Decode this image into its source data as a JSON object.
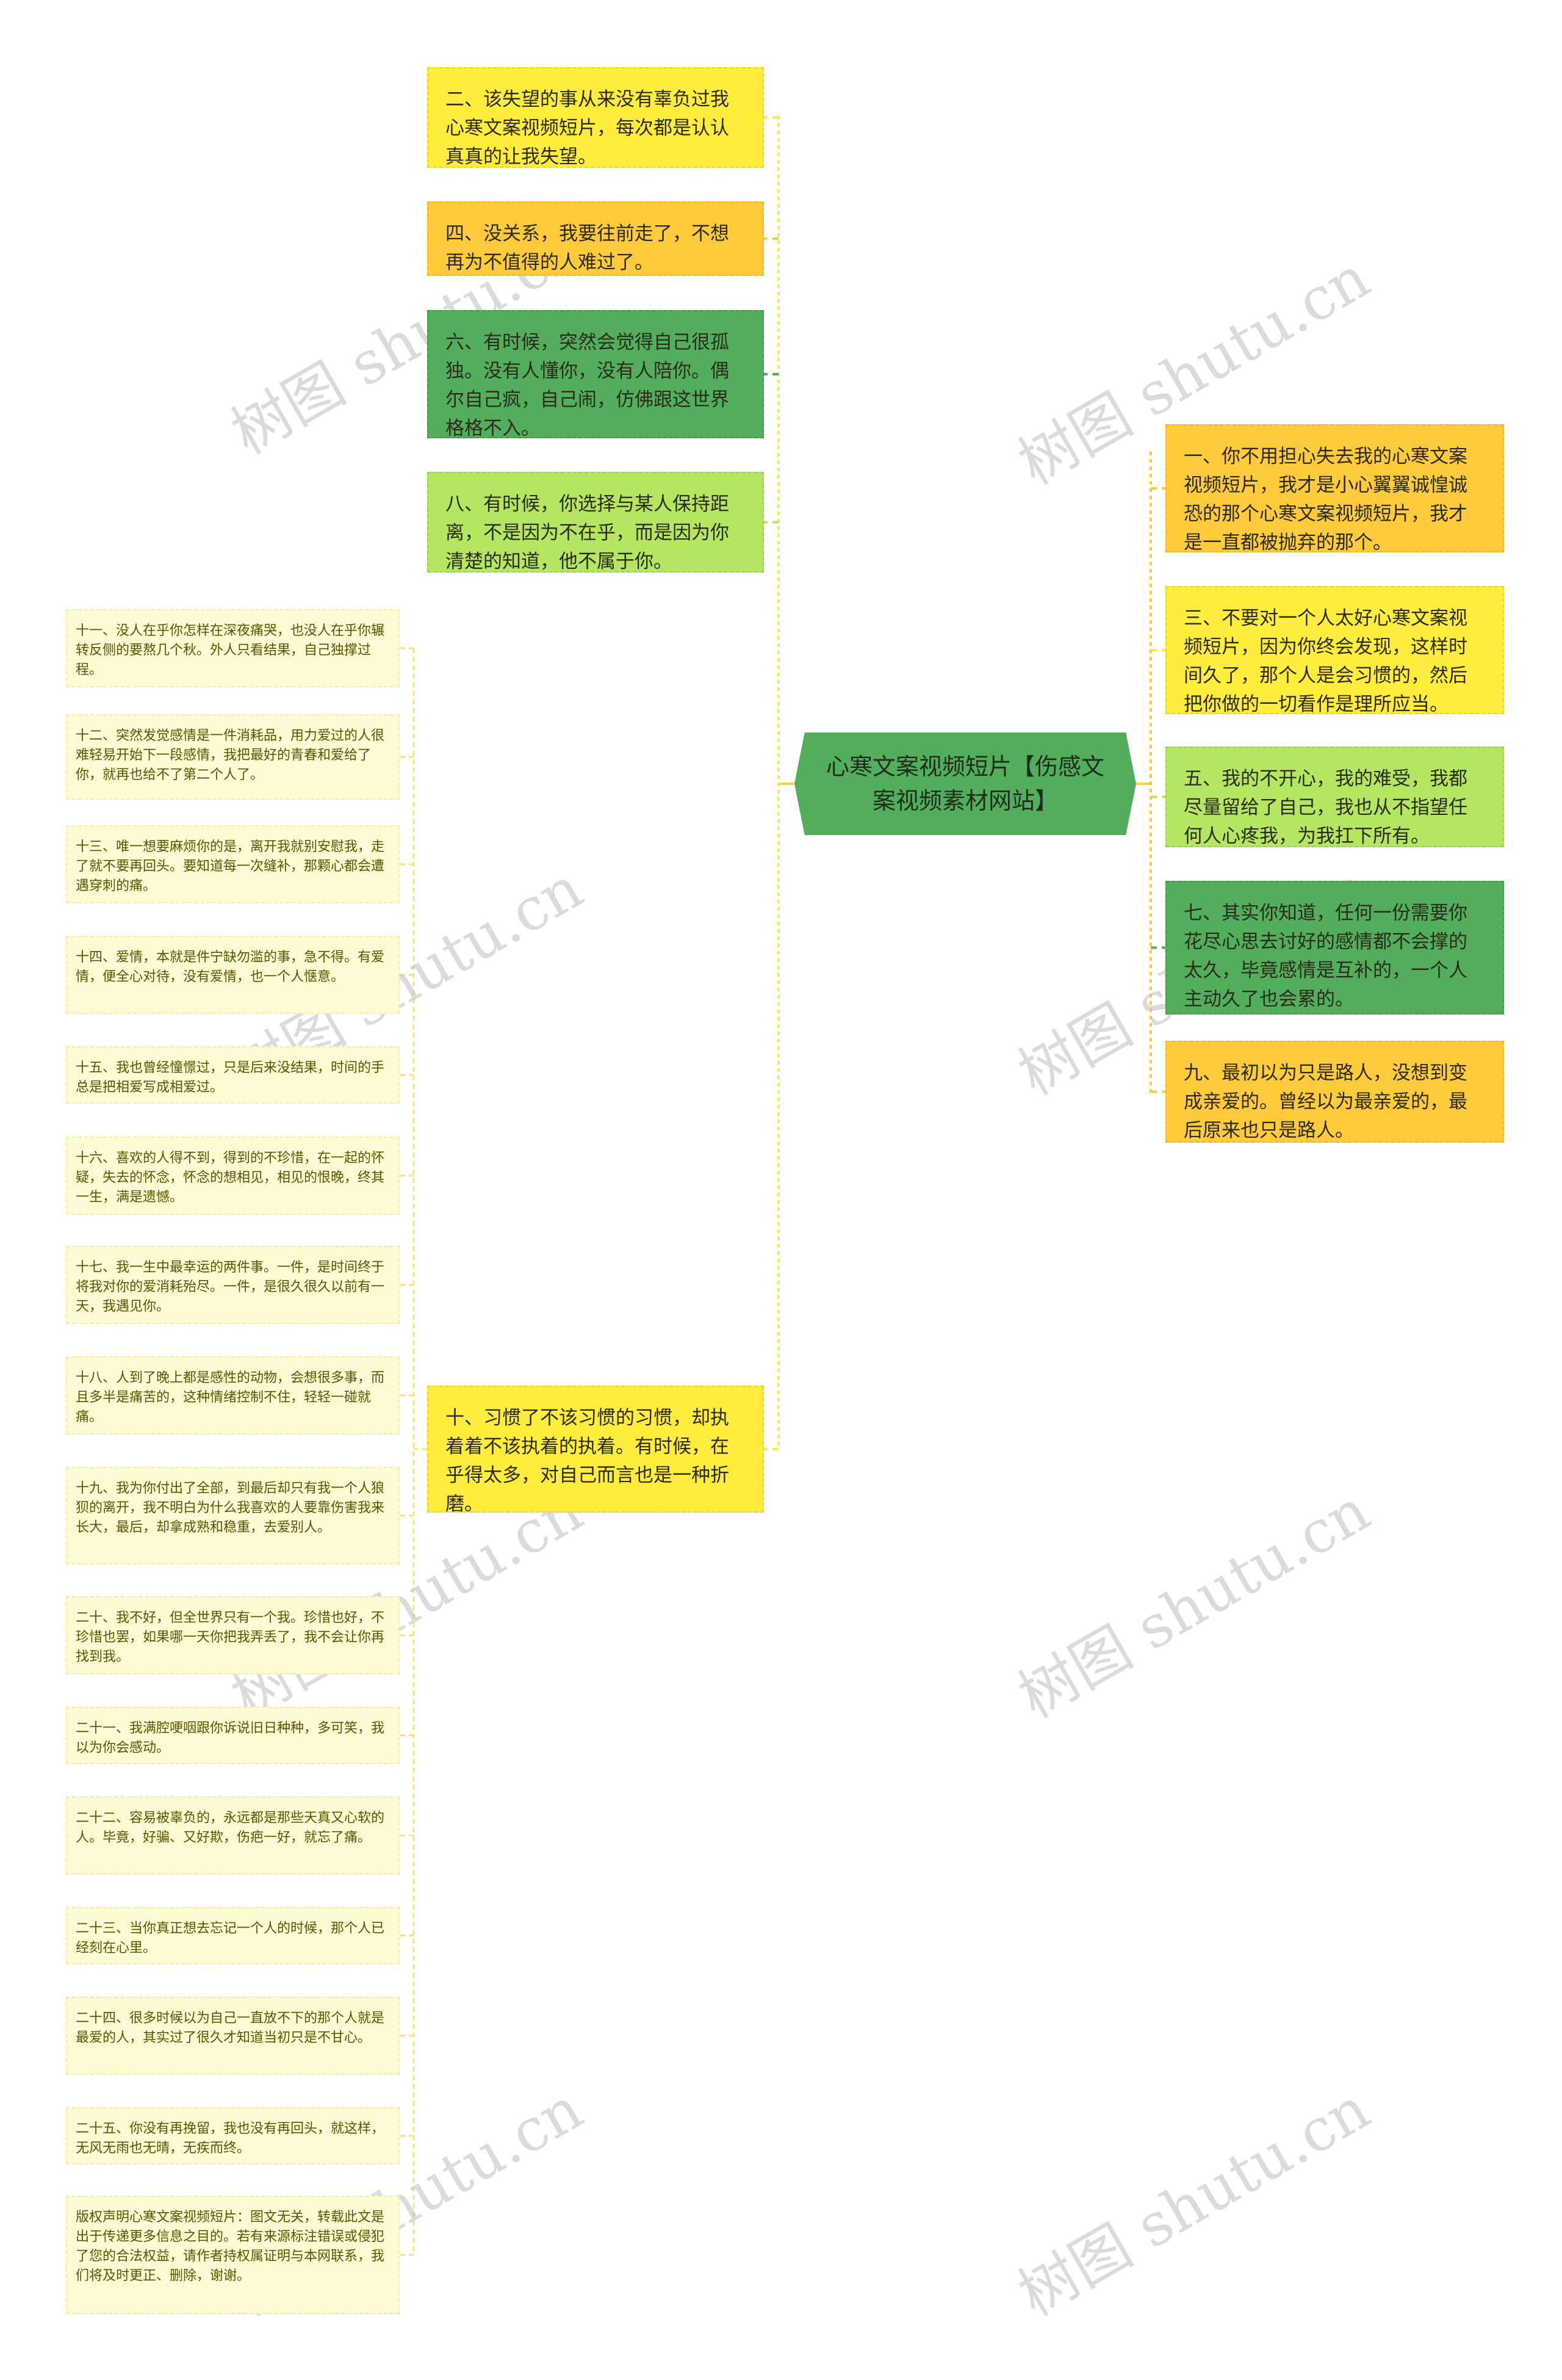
{
  "center": {
    "title": "心寒文案视频短片【伤感文案视频素材网站】"
  },
  "left_top_nodes": [
    {
      "text": "二、该失望的事从来没有辜负过我心寒文案视频短片，每次都是认认真真的让我失望。",
      "color": "#ffec3d"
    },
    {
      "text": "四、没关系，我要往前走了，不想再为不值得的人难过了。",
      "color": "#ffca3c"
    },
    {
      "text": "六、有时候，突然会觉得自己很孤独。没有人懂你，没有人陪你。偶尔自己疯，自己闹，仿佛跟这世界格格不入。",
      "color": "#52ae5c"
    },
    {
      "text": "八、有时候，你选择与某人保持距离，不是因为不在乎，而是因为你清楚的知道，他不属于你。",
      "color": "#b5e661"
    },
    {
      "text": "十、习惯了不该习惯的习惯，却执着着不该执着的执着。有时候，在乎得太多，对自己而言也是一种折磨。",
      "color": "#ffec3d"
    }
  ],
  "right_nodes": [
    {
      "text": "一、你不用担心失去我的心寒文案视频短片，我才是小心翼翼诚惶诚恐的那个心寒文案视频短片，我才是一直都被抛弃的那个。",
      "color": "#ffca3c"
    },
    {
      "text": "三、不要对一个人太好心寒文案视频短片，因为你终会发现，这样时间久了，那个人是会习惯的，然后把你做的一切看作是理所应当。",
      "color": "#ffec3d"
    },
    {
      "text": "五、我的不开心，我的难受，我都尽量留给了自己，我也从不指望任何人心疼我，为我扛下所有。",
      "color": "#b5e661"
    },
    {
      "text": "七、其实你知道，任何一份需要你花尽心思去讨好的感情都不会撑的太久，毕竟感情是互补的，一个人主动久了也会累的。",
      "color": "#52ae5c"
    },
    {
      "text": "九、最初以为只是路人，没想到变成亲爱的。曾经以为最亲爱的，最后原来也只是路人。",
      "color": "#ffca3c"
    }
  ],
  "left_sub_nodes": [
    {
      "text": "十一、没人在乎你怎样在深夜痛哭，也没人在乎你辗转反侧的要熬几个秋。外人只看结果，自己独撑过程。"
    },
    {
      "text": "十二、突然发觉感情是一件消耗品，用力爱过的人很难轻易开始下一段感情，我把最好的青春和爱给了你，就再也给不了第二个人了。"
    },
    {
      "text": "十三、唯一想要麻烦你的是，离开我就别安慰我，走了就不要再回头。要知道每一次缝补，那颗心都会遭遇穿刺的痛。"
    },
    {
      "text": "十四、爱情，本就是件宁缺勿滥的事，急不得。有爱情，便全心对待，没有爱情，也一个人惬意。"
    },
    {
      "text": "十五、我也曾经憧憬过，只是后来没结果，时间的手总是把相爱写成相爱过。"
    },
    {
      "text": "十六、喜欢的人得不到，得到的不珍惜，在一起的怀疑，失去的怀念，怀念的想相见，相见的恨晚，终其一生，满是遗憾。"
    },
    {
      "text": "十七、我一生中最幸运的两件事。一件，是时间终于将我对你的爱消耗殆尽。一件，是很久很久以前有一天，我遇见你。"
    },
    {
      "text": "十八、人到了晚上都是感性的动物，会想很多事，而且多半是痛苦的，这种情绪控制不住，轻轻一碰就痛。"
    },
    {
      "text": "十九、我为你付出了全部，到最后却只有我一个人狼狈的离开，我不明白为什么我喜欢的人要靠伤害我来长大，最后，却拿成熟和稳重，去爱别人。"
    },
    {
      "text": "二十、我不好，但全世界只有一个我。珍惜也好，不珍惜也罢，如果哪一天你把我弄丢了，我不会让你再找到我。"
    },
    {
      "text": "二十一、我满腔哽咽跟你诉说旧日种种，多可笑，我以为你会感动。"
    },
    {
      "text": "二十二、容易被辜负的，永远都是那些天真又心软的人。毕竟，好骗、又好欺，伤疤一好，就忘了痛。"
    },
    {
      "text": "二十三、当你真正想去忘记一个人的时候，那个人已经刻在心里。"
    },
    {
      "text": "二十四、很多时候以为自己一直放不下的那个人就是最爱的人，其实过了很久才知道当初只是不甘心。"
    },
    {
      "text": "二十五、你没有再挽留，我也没有再回头，就这样，无风无雨也无晴，无疾而终。"
    },
    {
      "text": "版权声明心寒文案视频短片：图文无关，转载此文是出于传递更多信息之目的。若有来源标注错误或侵犯了您的合法权益，请作者持权属证明与本网联系，我们将及时更正、删除，谢谢。"
    }
  ],
  "watermark": {
    "text": "树图 shutu.cn"
  }
}
